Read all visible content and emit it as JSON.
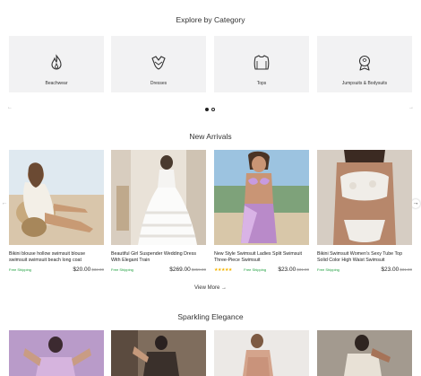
{
  "categories_section": {
    "title": "Explore by Category",
    "items": [
      {
        "label": "Beachwear",
        "icon": "flame-icon"
      },
      {
        "label": "Dresses",
        "icon": "dress-icon"
      },
      {
        "label": "Tops",
        "icon": "shirt-icon"
      },
      {
        "label": "Jumpsuits & Bodysuits",
        "icon": "badge-icon"
      }
    ],
    "prev_arrow": "←",
    "next_arrow": "→",
    "carousel_pages": 2,
    "active_page": 1
  },
  "new_arrivals": {
    "title": "New Arrivals",
    "prev_arrow": "←",
    "next_arrow": "→",
    "view_more": "View More →",
    "products": [
      {
        "title": "Bikini blouse hollow swimsuit blouse swimsuit swimsuit beach long coat",
        "shipping": "Free Shipping",
        "price": "$20.00",
        "old_price": "$32.00",
        "stars": ""
      },
      {
        "title": "Beautiful Girl Suspender Wedding Dress With Elegant Train",
        "shipping": "Free Shipping",
        "price": "$269.00",
        "old_price": "$359.00",
        "stars": ""
      },
      {
        "title": "New Style Swimsuit Ladies Split Swimsuit Three-Piece Swimsuit",
        "shipping": "Free Shipping",
        "price": "$23.00",
        "old_price": "$31.00",
        "stars": "★★★★★"
      },
      {
        "title": "Bikini Swimsuit Women's Sexy Tube Top Solid Color High Waist Swimsuit",
        "shipping": "Free Shipping",
        "price": "$23.00",
        "old_price": "$31.00",
        "stars": ""
      }
    ]
  },
  "sparkling": {
    "title": "Sparkling Elegance"
  },
  "colors": {
    "card_bg": "#f2f2f3",
    "free_shipping": "#1a9d3a",
    "star": "#f5b400"
  }
}
